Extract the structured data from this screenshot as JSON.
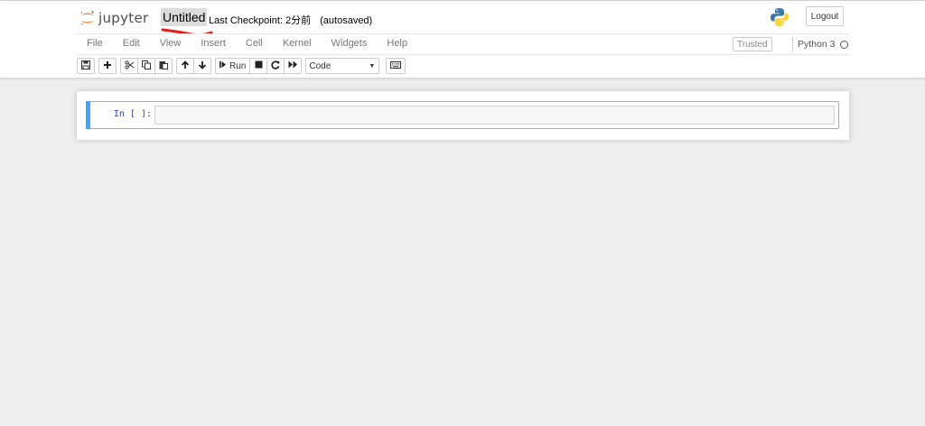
{
  "app": {
    "logo_text": "jupyter",
    "notebook_name": "Untitled",
    "checkpoint": "Last Checkpoint: 2分前",
    "autosave": "(autosaved)",
    "logout_label": "Logout"
  },
  "menubar": {
    "items": [
      "File",
      "Edit",
      "View",
      "Insert",
      "Cell",
      "Kernel",
      "Widgets",
      "Help"
    ],
    "trusted_label": "Trusted",
    "kernel_name": "Python 3"
  },
  "toolbar": {
    "run_label": "Run",
    "cell_type": "Code"
  },
  "cells": [
    {
      "prompt": "In [ ]:",
      "source": ""
    }
  ],
  "colors": {
    "cell_selected_bar": "#42a5f5",
    "prompt_color": "#303f9f",
    "logo_orange": "#f37726",
    "annotation_red": "#e02020"
  }
}
